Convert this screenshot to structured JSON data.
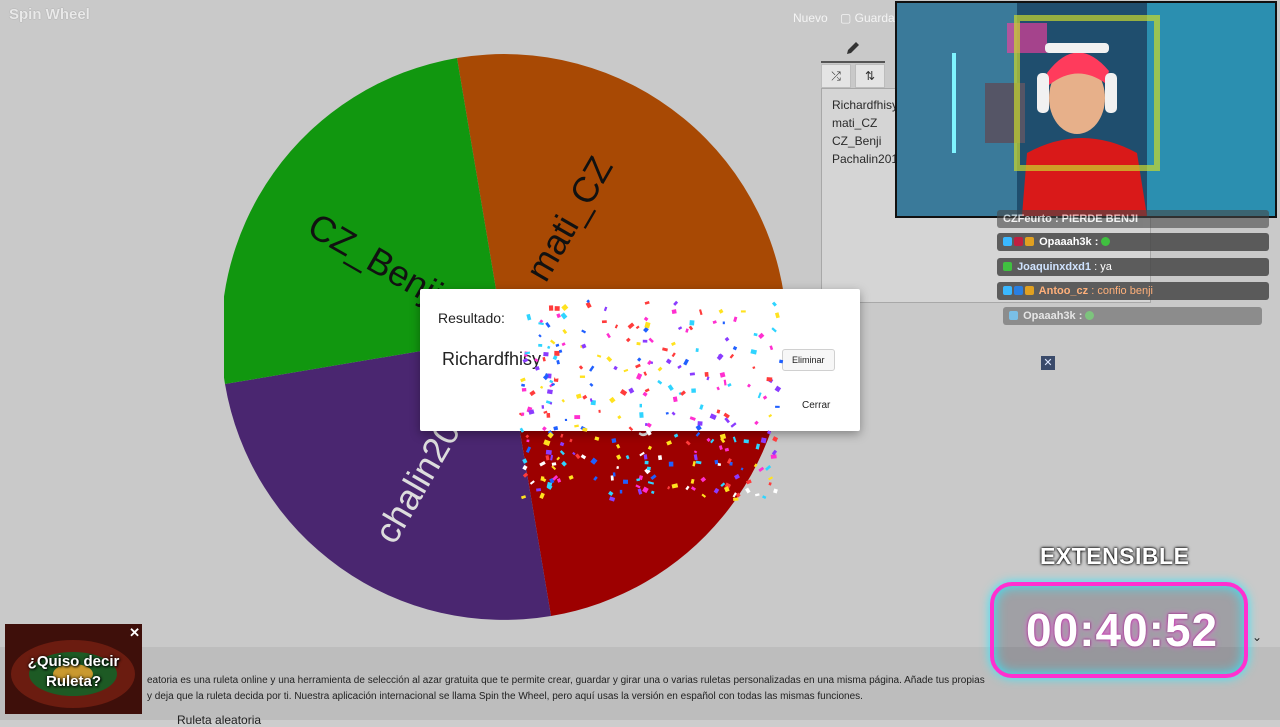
{
  "app": {
    "logo": "Spin Wheel",
    "new_label": "Nuevo",
    "save_label": "Guardar"
  },
  "wheel": {
    "segments": [
      {
        "label": "mati_CZ",
        "color": "#a84904"
      },
      {
        "label": "Richardfhisy",
        "color": "#9d0000"
      },
      {
        "label": "Pachalin2011",
        "color": "#4a2670"
      },
      {
        "label": "CZ_Benji",
        "color": "#11970f"
      }
    ],
    "visible_labels": {
      "seg1": "mati_CZ",
      "seg2": "hisy",
      "seg3": "chalin2011",
      "seg4": "CZ_Benji"
    }
  },
  "panel": {
    "entries": [
      "Richardfhisy",
      "mati_CZ",
      "CZ_Benji",
      "Pachalin2011"
    ]
  },
  "dialog": {
    "title": "Resultado:",
    "result": "Richardfhisy",
    "delete_label": "Eliminar",
    "close_label": "Cerrar"
  },
  "chat": [
    {
      "user": "Opaaah3k",
      "text": "",
      "user_color": "#ffffff"
    },
    {
      "user": "Joaquinxdxd1",
      "text": " : ya",
      "user_color": "#cfe3ff"
    },
    {
      "user": "Antoo_cz",
      "text": " : confio benji",
      "user_color": "#ffb07a"
    },
    {
      "user": "Opaaah3k",
      "text": "",
      "user_color": "#ffffff"
    }
  ],
  "chat_partial": "CZFeurto : PIERDE BENJI",
  "overlay": {
    "extensible": "EXTENSIBLE",
    "timer": "00:40:52"
  },
  "footer": {
    "desc_line1": "eatoria es una ruleta online y una herramienta de selección al azar gratuita que te permite crear, guardar y girar una o varias ruletas personalizadas en una misma página. Añade tus propias",
    "desc_line2": "y deja que la ruleta decida por ti. Nuestra aplicación internacional se llama Spin the Wheel, pero aquí usas la versión en español con todas las mismas funciones.",
    "bottom_title": "Ruleta aleatoria"
  },
  "ad": {
    "text": "¿Quiso decir Ruleta?",
    "close": "✕"
  }
}
